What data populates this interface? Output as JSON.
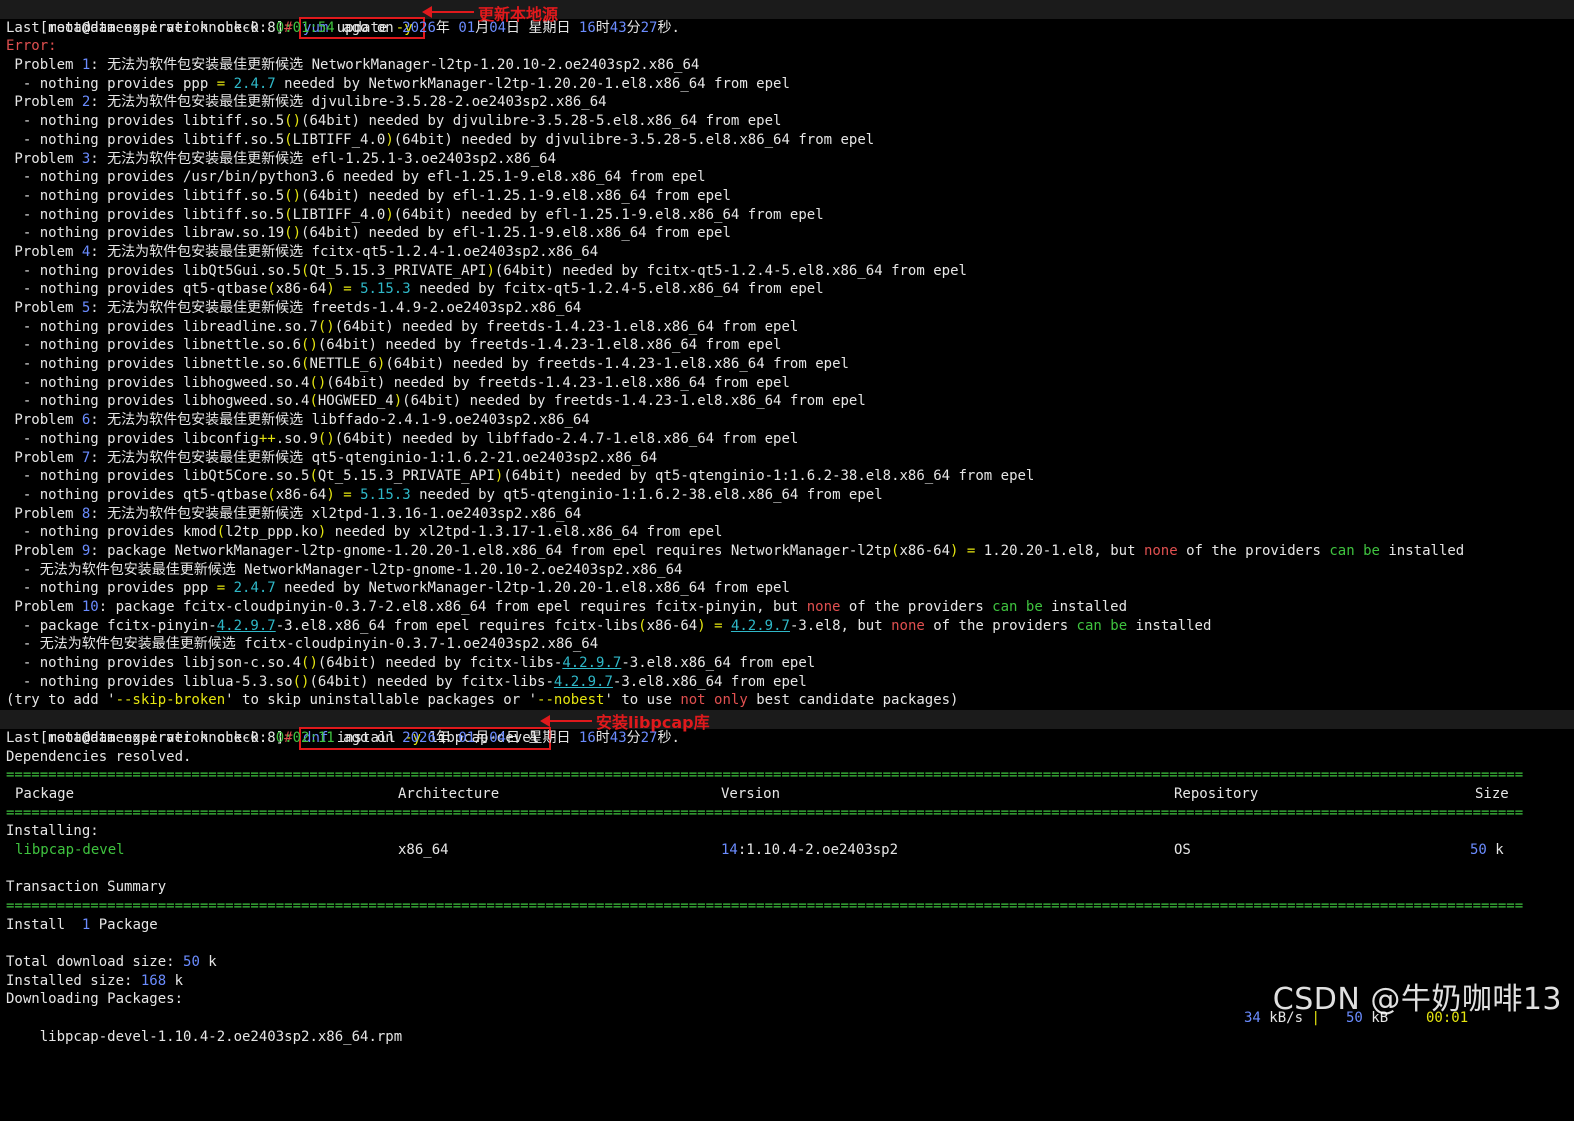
{
  "prompt": "[root@damengserver knock-0.8]",
  "commands": {
    "update": {
      "pre": "yum",
      "post": " update ",
      "flag": "-y"
    },
    "install": {
      "pre": "dnf",
      "post": " install ",
      "flag": "-y",
      "arg": " libpcap-devel "
    }
  },
  "annotations": {
    "update": "更新本地源",
    "install": "安装libpcap库"
  },
  "watermark": "CSDN @牛奶咖啡13",
  "lines_top": [
    [
      [
        "Last metadata expiration check: ",
        ""
      ],
      [
        "0:01:54",
        "g"
      ],
      [
        " ago on ",
        ""
      ],
      [
        "2026",
        "b"
      ],
      [
        "年 ",
        ""
      ],
      [
        "01",
        "b"
      ],
      [
        "月",
        ""
      ],
      [
        "04",
        "b"
      ],
      [
        "日 星期日 ",
        ""
      ],
      [
        "16",
        "b"
      ],
      [
        "时",
        ""
      ],
      [
        "43",
        "b"
      ],
      [
        "分",
        ""
      ],
      [
        "27",
        "b"
      ],
      [
        "秒.",
        ""
      ]
    ],
    [
      [
        "Error:",
        "r"
      ]
    ],
    [
      [
        " Problem ",
        ""
      ],
      [
        "1",
        "b"
      ],
      [
        ": 无法为软件包安装最佳更新候选 NetworkManager-l2tp-1.20.10-2.oe2403sp2.x86_64",
        ""
      ]
    ],
    [
      [
        "  - nothing provides ppp ",
        ""
      ],
      [
        "=",
        "y"
      ],
      [
        " ",
        ""
      ],
      [
        "2.4.7",
        "c"
      ],
      [
        " needed by NetworkManager-l2tp-1.20.20-1.el8.x86_64 from epel",
        ""
      ]
    ],
    [
      [
        " Problem ",
        ""
      ],
      [
        "2",
        "b"
      ],
      [
        ": 无法为软件包安装最佳更新候选 djvulibre-3.5.28-2.oe2403sp2.x86_64",
        ""
      ]
    ],
    [
      [
        "  - nothing provides libtiff.so.5",
        ""
      ],
      [
        "()",
        "y"
      ],
      [
        "(64bit)",
        ""
      ],
      [
        " needed by djvulibre-3.5.28-5.el8.x86_64 from epel",
        ""
      ]
    ],
    [
      [
        "  - nothing provides libtiff.so.5",
        ""
      ],
      [
        "(",
        "y"
      ],
      [
        "LIBTIFF_4.0",
        ""
      ],
      [
        ")",
        "y"
      ],
      [
        "(64bit)",
        ""
      ],
      [
        " needed by djvulibre-3.5.28-5.el8.x86_64 from epel",
        ""
      ]
    ],
    [
      [
        " Problem ",
        ""
      ],
      [
        "3",
        "b"
      ],
      [
        ": 无法为软件包安装最佳更新候选 efl-1.25.1-3.oe2403sp2.x86_64",
        ""
      ]
    ],
    [
      [
        "  - nothing provides /usr/bin/python3.6 needed by efl-1.25.1-9.el8.x86_64 from epel",
        ""
      ]
    ],
    [
      [
        "  - nothing provides libtiff.so.5",
        ""
      ],
      [
        "()",
        "y"
      ],
      [
        "(64bit)",
        ""
      ],
      [
        " needed by efl-1.25.1-9.el8.x86_64 from epel",
        ""
      ]
    ],
    [
      [
        "  - nothing provides libtiff.so.5",
        ""
      ],
      [
        "(",
        "y"
      ],
      [
        "LIBTIFF_4.0",
        ""
      ],
      [
        ")",
        "y"
      ],
      [
        "(64bit)",
        ""
      ],
      [
        " needed by efl-1.25.1-9.el8.x86_64 from epel",
        ""
      ]
    ],
    [
      [
        "  - nothing provides libraw.so.19",
        ""
      ],
      [
        "()",
        "y"
      ],
      [
        "(64bit)",
        ""
      ],
      [
        " needed by efl-1.25.1-9.el8.x86_64 from epel",
        ""
      ]
    ],
    [
      [
        " Problem ",
        ""
      ],
      [
        "4",
        "b"
      ],
      [
        ": 无法为软件包安装最佳更新候选 fcitx-qt5-1.2.4-1.oe2403sp2.x86_64",
        ""
      ]
    ],
    [
      [
        "  - nothing provides libQt5Gui.so.5",
        ""
      ],
      [
        "(",
        "y"
      ],
      [
        "Qt_5.15.3_PRIVATE_API",
        ""
      ],
      [
        ")",
        "y"
      ],
      [
        "(64bit)",
        ""
      ],
      [
        " needed by fcitx-qt5-1.2.4-5.el8.x86_64 from epel",
        ""
      ]
    ],
    [
      [
        "  - nothing provides qt5-qtbase",
        ""
      ],
      [
        "(",
        "y"
      ],
      [
        "x86-64",
        ""
      ],
      [
        ")",
        "y"
      ],
      [
        " ",
        ""
      ],
      [
        "=",
        "y"
      ],
      [
        " ",
        ""
      ],
      [
        "5.15.3",
        "c"
      ],
      [
        " needed by fcitx-qt5-1.2.4-5.el8.x86_64 from epel",
        ""
      ]
    ],
    [
      [
        " Problem ",
        ""
      ],
      [
        "5",
        "b"
      ],
      [
        ": 无法为软件包安装最佳更新候选 freetds-1.4.9-2.oe2403sp2.x86_64",
        ""
      ]
    ],
    [
      [
        "  - nothing provides libreadline.so.7",
        ""
      ],
      [
        "()",
        "y"
      ],
      [
        "(64bit)",
        ""
      ],
      [
        " needed by freetds-1.4.23-1.el8.x86_64 from epel",
        ""
      ]
    ],
    [
      [
        "  - nothing provides libnettle.so.6",
        ""
      ],
      [
        "()",
        "y"
      ],
      [
        "(64bit)",
        ""
      ],
      [
        " needed by freetds-1.4.23-1.el8.x86_64 from epel",
        ""
      ]
    ],
    [
      [
        "  - nothing provides libnettle.so.6",
        ""
      ],
      [
        "(",
        "y"
      ],
      [
        "NETTLE_6",
        ""
      ],
      [
        ")",
        "y"
      ],
      [
        "(64bit)",
        ""
      ],
      [
        " needed by freetds-1.4.23-1.el8.x86_64 from epel",
        ""
      ]
    ],
    [
      [
        "  - nothing provides libhogweed.so.4",
        ""
      ],
      [
        "()",
        "y"
      ],
      [
        "(64bit)",
        ""
      ],
      [
        " needed by freetds-1.4.23-1.el8.x86_64 from epel",
        ""
      ]
    ],
    [
      [
        "  - nothing provides libhogweed.so.4",
        ""
      ],
      [
        "(",
        "y"
      ],
      [
        "HOGWEED_4",
        ""
      ],
      [
        ")",
        "y"
      ],
      [
        "(64bit)",
        ""
      ],
      [
        " needed by freetds-1.4.23-1.el8.x86_64 from epel",
        ""
      ]
    ],
    [
      [
        " Problem ",
        ""
      ],
      [
        "6",
        "b"
      ],
      [
        ": 无法为软件包安装最佳更新候选 libffado-2.4.1-9.oe2403sp2.x86_64",
        ""
      ]
    ],
    [
      [
        "  - nothing provides libconfig",
        ""
      ],
      [
        "++",
        "y"
      ],
      [
        ".so.9",
        ""
      ],
      [
        "()",
        "y"
      ],
      [
        "(64bit)",
        ""
      ],
      [
        " needed by libffado-2.4.7-1.el8.x86_64 from epel",
        ""
      ]
    ],
    [
      [
        " Problem ",
        ""
      ],
      [
        "7",
        "b"
      ],
      [
        ": 无法为软件包安装最佳更新候选 qt5-qtenginio-1:1.6.2-21.oe2403sp2.x86_64",
        ""
      ]
    ],
    [
      [
        "  - nothing provides libQt5Core.so.5",
        ""
      ],
      [
        "(",
        "y"
      ],
      [
        "Qt_5.15.3_PRIVATE_API",
        ""
      ],
      [
        ")",
        "y"
      ],
      [
        "(64bit)",
        ""
      ],
      [
        " needed by qt5-qtenginio-1:1.6.2-38.el8.x86_64 from epel",
        ""
      ]
    ],
    [
      [
        "  - nothing provides qt5-qtbase",
        ""
      ],
      [
        "(",
        "y"
      ],
      [
        "x86-64",
        ""
      ],
      [
        ")",
        "y"
      ],
      [
        " ",
        ""
      ],
      [
        "=",
        "y"
      ],
      [
        " ",
        ""
      ],
      [
        "5.15.3",
        "c"
      ],
      [
        " needed by qt5-qtenginio-1:1.6.2-38.el8.x86_64 from epel",
        ""
      ]
    ],
    [
      [
        " Problem ",
        ""
      ],
      [
        "8",
        "b"
      ],
      [
        ": 无法为软件包安装最佳更新候选 xl2tpd-1.3.16-1.oe2403sp2.x86_64",
        ""
      ]
    ],
    [
      [
        "  - nothing provides kmod",
        ""
      ],
      [
        "(",
        "y"
      ],
      [
        "l2tp_ppp.ko",
        ""
      ],
      [
        ")",
        "y"
      ],
      [
        " needed by xl2tpd-1.3.17-1.el8.x86_64 from epel",
        ""
      ]
    ],
    [
      [
        " Problem ",
        ""
      ],
      [
        "9",
        "b"
      ],
      [
        ": package NetworkManager-l2tp-gnome-1.20.20-1.el8.x86_64 from epel requires NetworkManager-l2tp",
        ""
      ],
      [
        "(",
        "y"
      ],
      [
        "x86-64",
        ""
      ],
      [
        ")",
        "y"
      ],
      [
        " ",
        ""
      ],
      [
        "=",
        "y"
      ],
      [
        " 1.20.20-1.el8, but ",
        ""
      ],
      [
        "none",
        "r"
      ],
      [
        " of the providers ",
        ""
      ],
      [
        "can be",
        "g"
      ],
      [
        " installed",
        ""
      ]
    ],
    [
      [
        "  - 无法为软件包安装最佳更新候选 NetworkManager-l2tp-gnome-1.20.10-2.oe2403sp2.x86_64",
        ""
      ]
    ],
    [
      [
        "  - nothing provides ppp ",
        ""
      ],
      [
        "=",
        "y"
      ],
      [
        " ",
        ""
      ],
      [
        "2.4.7",
        "c"
      ],
      [
        " needed by NetworkManager-l2tp-1.20.20-1.el8.x86_64 from epel",
        ""
      ]
    ],
    [
      [
        " Problem ",
        ""
      ],
      [
        "10",
        "b"
      ],
      [
        ": package fcitx-cloudpinyin-0.3.7-2.el8.x86_64 from epel requires fcitx-pinyin, but ",
        ""
      ],
      [
        "none",
        "r"
      ],
      [
        " of the providers ",
        ""
      ],
      [
        "can be",
        "g"
      ],
      [
        " installed",
        ""
      ]
    ],
    [
      [
        "  - package fcitx-pinyin-",
        ""
      ],
      [
        "4.2.9.7",
        "c u"
      ],
      [
        "-3.el8.x86_64 from epel requires fcitx-libs",
        ""
      ],
      [
        "(",
        "y"
      ],
      [
        "x86-64",
        ""
      ],
      [
        ")",
        "y"
      ],
      [
        " ",
        ""
      ],
      [
        "=",
        "y"
      ],
      [
        " ",
        ""
      ],
      [
        "4.2.9.7",
        "c u"
      ],
      [
        "-3.el8, but ",
        ""
      ],
      [
        "none",
        "r"
      ],
      [
        " of the providers ",
        ""
      ],
      [
        "can be",
        "g"
      ],
      [
        " installed",
        ""
      ]
    ],
    [
      [
        "  - 无法为软件包安装最佳更新候选 fcitx-cloudpinyin-0.3.7-1.oe2403sp2.x86_64",
        ""
      ]
    ],
    [
      [
        "  - nothing provides libjson-c.so.4",
        ""
      ],
      [
        "()",
        "y"
      ],
      [
        "(64bit)",
        ""
      ],
      [
        " needed by fcitx-libs-",
        ""
      ],
      [
        "4.2.9.7",
        "c u"
      ],
      [
        "-3.el8.x86_64 from epel",
        ""
      ]
    ],
    [
      [
        "  - nothing provides liblua-5.3.so",
        ""
      ],
      [
        "()",
        "y"
      ],
      [
        "(64bit)",
        ""
      ],
      [
        " needed by fcitx-libs-",
        ""
      ],
      [
        "4.2.9.7",
        "c u"
      ],
      [
        "-3.el8.x86_64 from epel",
        ""
      ]
    ],
    [
      [
        "(try to add '",
        ""
      ],
      [
        "--skip-broken",
        "y"
      ],
      [
        "' to skip uninstallable packages or '",
        ""
      ],
      [
        "--nobest",
        "y"
      ],
      [
        "' to use ",
        ""
      ],
      [
        "not only",
        "r"
      ],
      [
        " best candidate packages)",
        ""
      ]
    ]
  ],
  "lines_install": [
    [
      [
        "Last metadata expiration check: ",
        ""
      ],
      [
        "0:02:11",
        "g"
      ],
      [
        " ago on ",
        ""
      ],
      [
        "2026",
        "b"
      ],
      [
        "年 ",
        ""
      ],
      [
        "01",
        "b"
      ],
      [
        "月",
        ""
      ],
      [
        "04",
        "b"
      ],
      [
        "日 星期日 ",
        ""
      ],
      [
        "16",
        "b"
      ],
      [
        "时",
        ""
      ],
      [
        "43",
        "b"
      ],
      [
        "分",
        ""
      ],
      [
        "27",
        "b"
      ],
      [
        "秒.",
        ""
      ]
    ],
    [
      [
        "Dependencies resolved.",
        ""
      ]
    ]
  ],
  "table": {
    "headers": {
      "package": "Package",
      "arch": "Architecture",
      "version": "Version",
      "repo": "Repository",
      "size": "Size"
    },
    "section": "Installing:",
    "row": {
      "package": "libpcap-devel",
      "arch": "x86_64",
      "version_epoch": "14",
      "version_rest": ":1.10.4-2.oe2403sp2",
      "repo": "OS",
      "size_num": "50",
      "size_unit": " k"
    }
  },
  "summary": {
    "title": "Transaction Summary",
    "install_label": "Install  ",
    "install_count": "1",
    "install_unit": " Package",
    "total_label": "Total download size: ",
    "total_num": "50",
    "total_unit": " k",
    "installed_label": "Installed size: ",
    "installed_num": "168",
    "installed_unit": " k",
    "downloading": "Downloading Packages:",
    "rpm": "libpcap-devel-1.10.4-2.oe2403sp2.x86_64.rpm",
    "speed_num": "34",
    "speed_unit": " kB/s",
    "sep": " | ",
    "size_num": "50",
    "size_unit": " kB",
    "time": "00:01"
  }
}
